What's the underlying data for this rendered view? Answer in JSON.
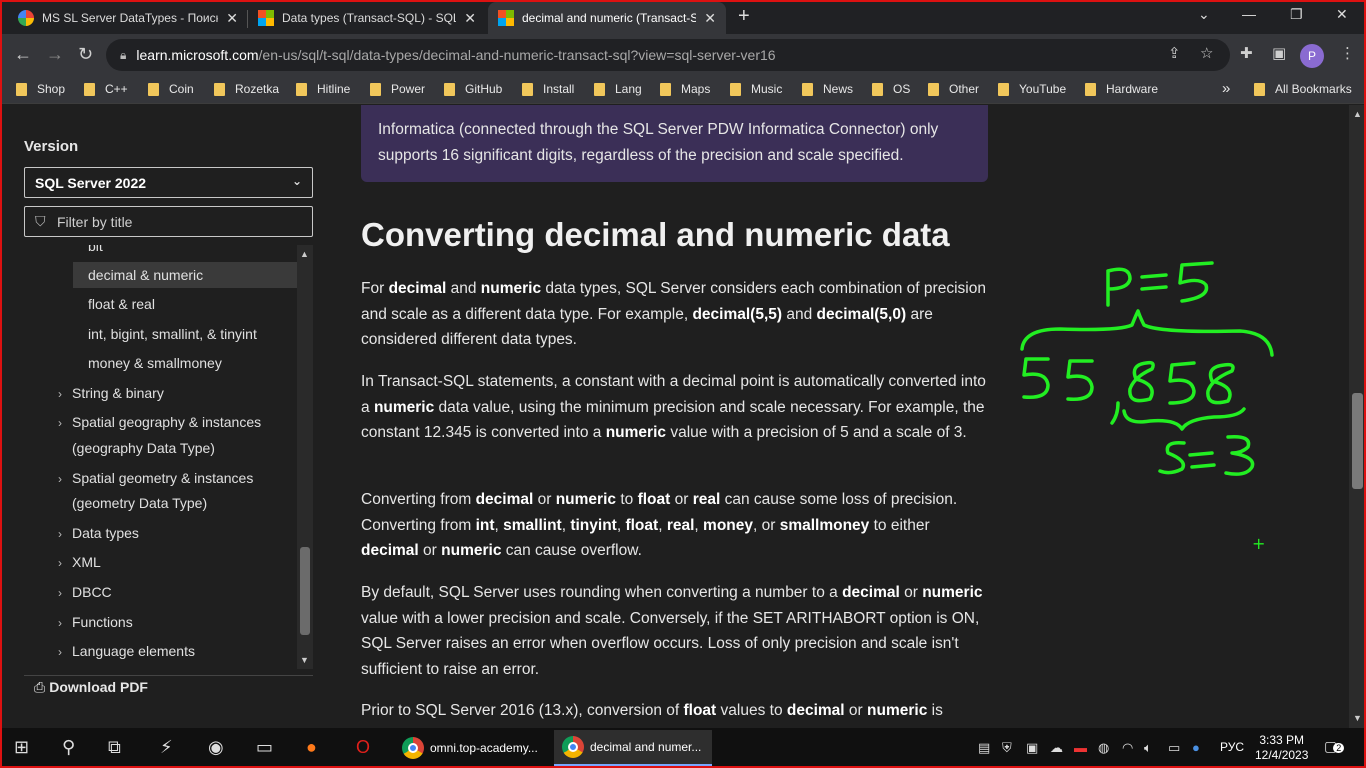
{
  "tabs": [
    {
      "title": "MS SL Server DataTypes - Поиск"
    },
    {
      "title": "Data types (Transact-SQL) - SQL"
    },
    {
      "title": "decimal and numeric (Transact-S"
    }
  ],
  "new_tab": "+",
  "url": {
    "host": "learn.microsoft.com",
    "path": "/en-us/sql/t-sql/data-types/decimal-and-numeric-transact-sql?view=sql-server-ver16"
  },
  "profile_initial": "P",
  "bookmarks": [
    "Shop",
    "C++",
    "Coin",
    "Rozetka",
    "Hitline",
    "Power",
    "GitHub",
    "Install",
    "Lang",
    "Maps",
    "Music",
    "News",
    "OS",
    "Other",
    "YouTube",
    "Hardware"
  ],
  "bookmarks_overflow": "»",
  "all_bookmarks": "All Bookmarks",
  "sidebar": {
    "version_label": "Version",
    "version_value": "SQL Server 2022",
    "filter_placeholder": "Filter by title",
    "toc": {
      "bit": "bit",
      "decimal": "decimal & numeric",
      "float": "float & real",
      "int": "int, bigint, smallint, & tinyint",
      "money": "money & smallmoney",
      "string": "String & binary",
      "geog1": "Spatial geography & instances",
      "geog2": "(geography Data Type)",
      "geom1": "Spatial geometry & instances",
      "geom2": "(geometry Data Type)",
      "datatypes": "Data types",
      "xml": "XML",
      "dbcc": "DBCC",
      "functions": "Functions",
      "language": "Language elements"
    },
    "download_pdf": "Download PDF"
  },
  "article": {
    "note_line1": "Informatica (connected through the SQL Server PDW Informatica Connector) only",
    "note_line2": "supports 16 significant digits, regardless of the precision and scale specified.",
    "heading": "Converting decimal and numeric data"
  },
  "handwriting": {
    "p_label": "p=5",
    "number": "55,858",
    "s_label": "s=3",
    "cursor": "+",
    "ink_color": "#22ee22"
  },
  "taskbar": {
    "app1": "omni.top-academy...",
    "app2": "decimal and numer...",
    "lang": "РУС",
    "time": "3:33 PM",
    "date": "12/4/2023",
    "notifications": "2"
  }
}
